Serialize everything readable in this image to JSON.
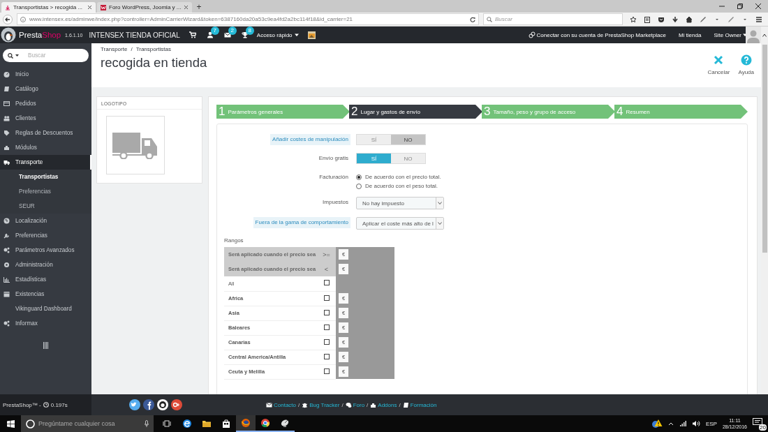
{
  "browser": {
    "tabs": [
      {
        "title": "Transportistas > recogida ...",
        "selected": true
      },
      {
        "title": "Foro WordPress, Joomla y ...",
        "selected": false
      }
    ],
    "new_tab": "+",
    "url": "www.intensex.es/adminwe/index.php?controller=AdminCarrierWizard&token=6387160da20a53c9ea4fd2a2bc114f18&id_carrier=21",
    "search": {
      "placeholder": "Buscar"
    }
  },
  "header": {
    "logo_a": "Presta",
    "logo_b": "Shop",
    "version": "1.6.1.10",
    "shop_name": "INTENSEX TIENDA OFICIAL",
    "badges": [
      {
        "count": "7"
      },
      {
        "count": "2"
      },
      {
        "count": "8"
      }
    ],
    "quick_access": "Acceso rápido",
    "connect": "Conectar con su cuenta de PrestaShop Marketplace",
    "my_shop": "Mi tienda",
    "user": "Site Owner"
  },
  "sidebar": {
    "search": {
      "placeholder": "Buscar"
    },
    "items": [
      {
        "label": "Inicio",
        "selected": false
      },
      {
        "label": "Catálogo",
        "selected": false
      },
      {
        "label": "Pedidos",
        "selected": false
      },
      {
        "label": "Clientes",
        "selected": false
      },
      {
        "label": "Reglas de Descuentos",
        "selected": false
      },
      {
        "label": "Módulos",
        "selected": false
      },
      {
        "label": "Transporte",
        "selected": true,
        "children": [
          {
            "label": "Transportistas",
            "selected": true
          },
          {
            "label": "Preferencias",
            "selected": false
          },
          {
            "label": "SEUR",
            "selected": false
          }
        ]
      },
      {
        "label": "Localización",
        "selected": false
      },
      {
        "label": "Preferencias",
        "selected": false
      },
      {
        "label": "Parámetros Avanzados",
        "selected": false
      },
      {
        "label": "Administración",
        "selected": false
      },
      {
        "label": "Estadísticas",
        "selected": false
      },
      {
        "label": "Existencias",
        "selected": false
      },
      {
        "label": "Vikinguard Dashboard",
        "selected": false
      },
      {
        "label": "Informax",
        "selected": false
      }
    ]
  },
  "page": {
    "breadcrumb": [
      {
        "label": "Transporte",
        "after": "/"
      },
      {
        "label": "Transportistas"
      }
    ],
    "title": "recogida en tienda",
    "actions": [
      {
        "kind": "cancel",
        "label": "Cancelar"
      },
      {
        "kind": "help",
        "label": "Ayuda"
      }
    ]
  },
  "logo_panel": {
    "heading": "LOGOTIPO"
  },
  "steps": [
    {
      "number": "1",
      "label": "Parámetros generales",
      "selected": false
    },
    {
      "number": "2",
      "label": "Lugar y gastos de envío",
      "selected": true
    },
    {
      "number": "3",
      "label": "Tamaño, peso y grupo de acceso",
      "selected": false
    },
    {
      "number": "4",
      "label": "Resumen",
      "selected": false
    }
  ],
  "form": {
    "fields": [
      {
        "kind": "switch",
        "label": "Añadir costes de manipulación",
        "hint": true,
        "options": [
          "SÍ",
          "NO"
        ],
        "on": false
      },
      {
        "kind": "switch",
        "label": "Envío gratis",
        "hint": false,
        "options": [
          "SÍ",
          "NO"
        ],
        "on": true
      },
      {
        "kind": "radio",
        "label": "Facturación",
        "hint": false,
        "options": [
          {
            "label": "De acuerdo con el precio total.",
            "selected": true
          },
          {
            "label": "De acuerdo con el peso total.",
            "selected": false
          }
        ]
      },
      {
        "kind": "select",
        "label": "Impuestos",
        "hint": false,
        "value": "No hay impuesto"
      },
      {
        "kind": "select",
        "label": "Fuera de la gama de comportamiento",
        "hint": true,
        "value": "Aplicar el coste más alto de l"
      }
    ],
    "ranges_title": "Rangos",
    "ranges": [
      {
        "label": "Será aplicado cuando el precio sea",
        "operator": ">=",
        "currency": "€"
      },
      {
        "label": "Será aplicado cuando el precio sea",
        "operator": "<",
        "currency": "€"
      }
    ],
    "zones": [
      {
        "kind": "all",
        "name": "All",
        "checked": false
      },
      {
        "kind": "zone",
        "name": "Africa",
        "checked": false,
        "currency": "€"
      },
      {
        "kind": "zone",
        "name": "Asia",
        "checked": false,
        "currency": "€"
      },
      {
        "kind": "zone",
        "name": "Baleares",
        "checked": false,
        "currency": "€"
      },
      {
        "kind": "zone",
        "name": "Canarias",
        "checked": false,
        "currency": "€"
      },
      {
        "kind": "zone",
        "name": "Central America/Antilla",
        "checked": false,
        "currency": "€"
      },
      {
        "kind": "zone",
        "name": "Ceuta y Melilla",
        "checked": false,
        "currency": "€"
      }
    ]
  },
  "footer": {
    "brand": "PrestaShop™ -",
    "load_time": "0.197s",
    "links": [
      {
        "label": "Contacto",
        "after": "/"
      },
      {
        "label": "Bug Tracker",
        "after": "/"
      },
      {
        "label": "Foro",
        "after": "/"
      },
      {
        "label": "Addons",
        "after": "/"
      },
      {
        "label": "Formación"
      }
    ]
  },
  "taskbar": {
    "search": {
      "placeholder": "Pregúntame cualquier cosa"
    },
    "language": "ESP",
    "time": "11:11",
    "date": "28/12/2016",
    "notifications": "20"
  }
}
